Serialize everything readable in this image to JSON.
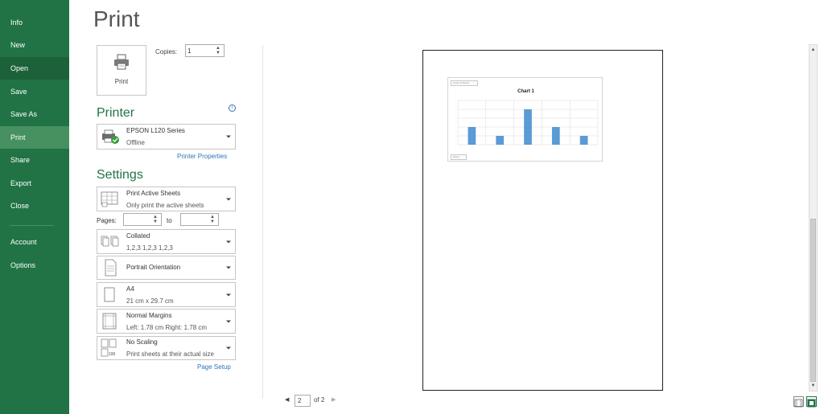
{
  "sidebar": {
    "items": [
      {
        "label": "Info"
      },
      {
        "label": "New"
      },
      {
        "label": "Open"
      },
      {
        "label": "Save"
      },
      {
        "label": "Save As"
      },
      {
        "label": "Print"
      },
      {
        "label": "Share"
      },
      {
        "label": "Export"
      },
      {
        "label": "Close"
      },
      {
        "label": "Account"
      },
      {
        "label": "Options"
      }
    ],
    "colors": {
      "background": "#217346",
      "active": "#46915f",
      "open": "#1c6139"
    }
  },
  "page_title": "Print",
  "print": {
    "button_label": "Print",
    "copies_label": "Copies:",
    "copies_value": "1"
  },
  "printer": {
    "heading": "Printer",
    "info_icon": "info-icon",
    "name": "EPSON L120 Series",
    "status": "Offline",
    "properties_link": "Printer Properties"
  },
  "settings": {
    "heading": "Settings",
    "active_sheets": {
      "title": "Print Active Sheets",
      "desc": "Only print the active sheets"
    },
    "pages_label": "Pages:",
    "pages_from": "",
    "to_label": "to",
    "pages_to": "",
    "collated": {
      "title": "Collated",
      "desc": "1,2,3    1,2,3    1,2,3"
    },
    "orientation": {
      "title": "Portrait Orientation"
    },
    "paper": {
      "title": "A4",
      "desc": "21 cm x 29.7 cm"
    },
    "margins": {
      "title": "Normal Margins",
      "desc": "Left:  1.78 cm    Right:  1.78 cm"
    },
    "scaling": {
      "title": "No Scaling",
      "desc": "Print sheets at their actual size"
    },
    "page_setup_link": "Page Setup"
  },
  "preview": {
    "current_page": "2",
    "total_pages": "of 2",
    "chart_title": "Chart 1",
    "field_button_top": "Count of Score",
    "field_button_bottom": "Score"
  },
  "chart_data": {
    "type": "bar",
    "title": "Chart 1",
    "categories": [
      "",
      "",
      "",
      "",
      ""
    ],
    "values": [
      2,
      1,
      4,
      2,
      1
    ],
    "ylim": [
      0,
      5
    ],
    "grid": true,
    "bar_color": "#5b9bd5"
  }
}
